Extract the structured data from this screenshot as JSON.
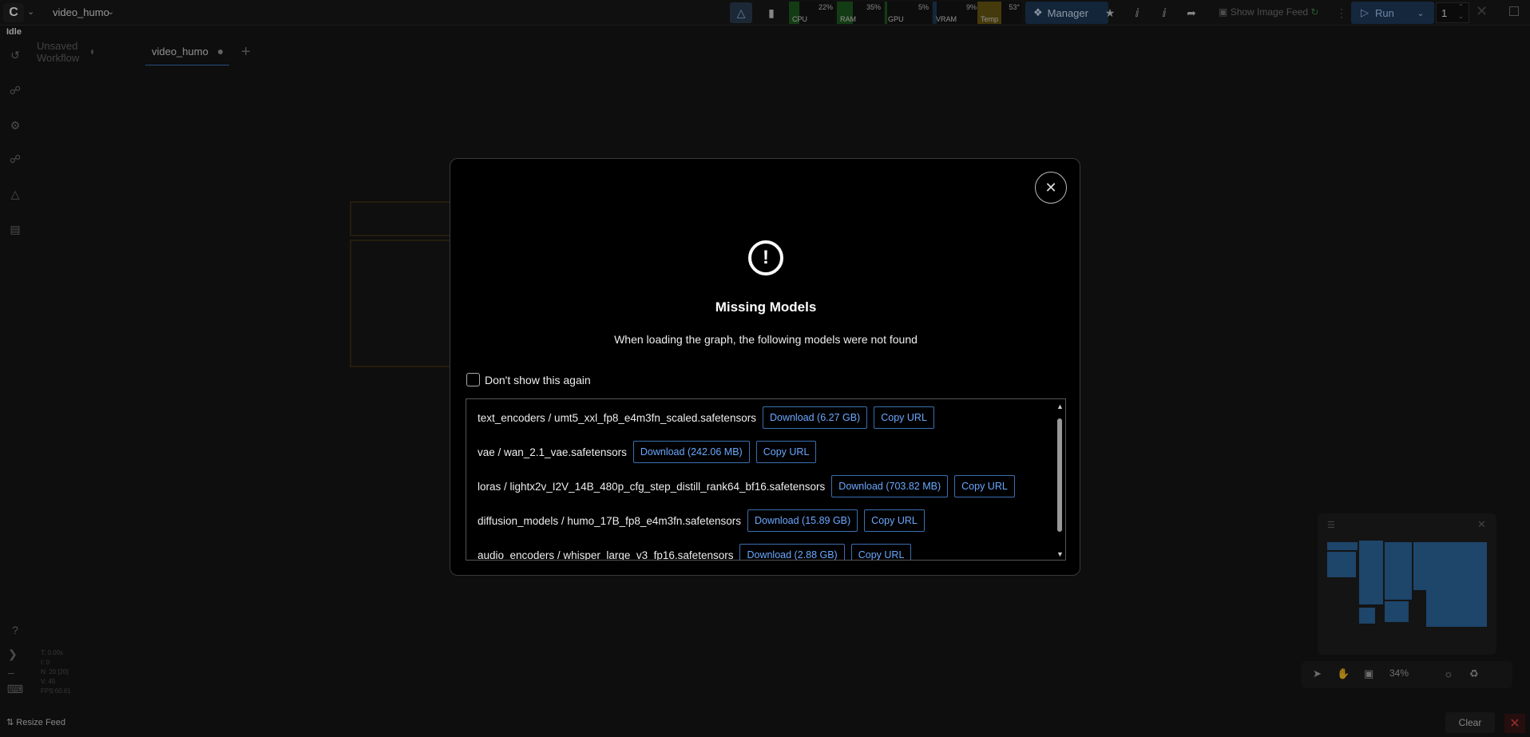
{
  "topbar": {
    "workflow_name": "video_humo",
    "status": "Idle",
    "meters": [
      {
        "label": "CPU",
        "value": "22%",
        "fill": 0.22,
        "color": "#1f5c1f"
      },
      {
        "label": "RAM",
        "value": "35%",
        "fill": 0.35,
        "color": "#1f5c1f"
      },
      {
        "label": "GPU",
        "value": "5%",
        "fill": 0.05,
        "color": "#1f5c1f"
      },
      {
        "label": "VRAM",
        "value": "9%",
        "fill": 0.09,
        "color": "#1f3e5c"
      },
      {
        "label": "Temp",
        "value": "53°",
        "fill": 0.53,
        "color": "#6b5a12"
      }
    ],
    "manager_label": "Manager",
    "show_feed_label": "Show Image Feed",
    "run_label": "Run",
    "run_count": "1"
  },
  "tabs": [
    {
      "label": "Unsaved Workflow",
      "active": false
    },
    {
      "label": "video_humo",
      "active": true
    }
  ],
  "stats": [
    "T: 0.00s",
    "I: 0",
    "N: 20 [20]",
    "V: 45",
    "FPS:60.61"
  ],
  "bottom": {
    "resize_feed_label": "Resize Feed",
    "clear_label": "Clear"
  },
  "canvas": {
    "zoom": "34%"
  },
  "dialog": {
    "title": "Missing Models",
    "subtitle": "When loading the graph, the following models were not found",
    "dont_show_label": "Don't show this again",
    "models": [
      {
        "path": "text_encoders / umt5_xxl_fp8_e4m3fn_scaled.safetensors",
        "download": "Download (6.27 GB)",
        "copy": "Copy URL"
      },
      {
        "path": "vae / wan_2.1_vae.safetensors",
        "download": "Download (242.06 MB)",
        "copy": "Copy URL"
      },
      {
        "path": "loras / lightx2v_I2V_14B_480p_cfg_step_distill_rank64_bf16.safetensors",
        "download": "Download (703.82 MB)",
        "copy": "Copy URL"
      },
      {
        "path": "diffusion_models / humo_17B_fp8_e4m3fn.safetensors",
        "download": "Download (15.89 GB)",
        "copy": "Copy URL"
      },
      {
        "path": "audio_encoders / whisper_large_v3_fp16.safetensors",
        "download": "Download (2.88 GB)",
        "copy": "Copy URL"
      }
    ]
  },
  "icons": {
    "history": "history-icon",
    "search": "node-library-icon",
    "models": "model-library-icon",
    "workflows": "workflows-icon",
    "templates": "templates-icon",
    "help": "help-icon",
    "terminal": "terminal-icon",
    "keyboard": "keyboard-icon"
  }
}
